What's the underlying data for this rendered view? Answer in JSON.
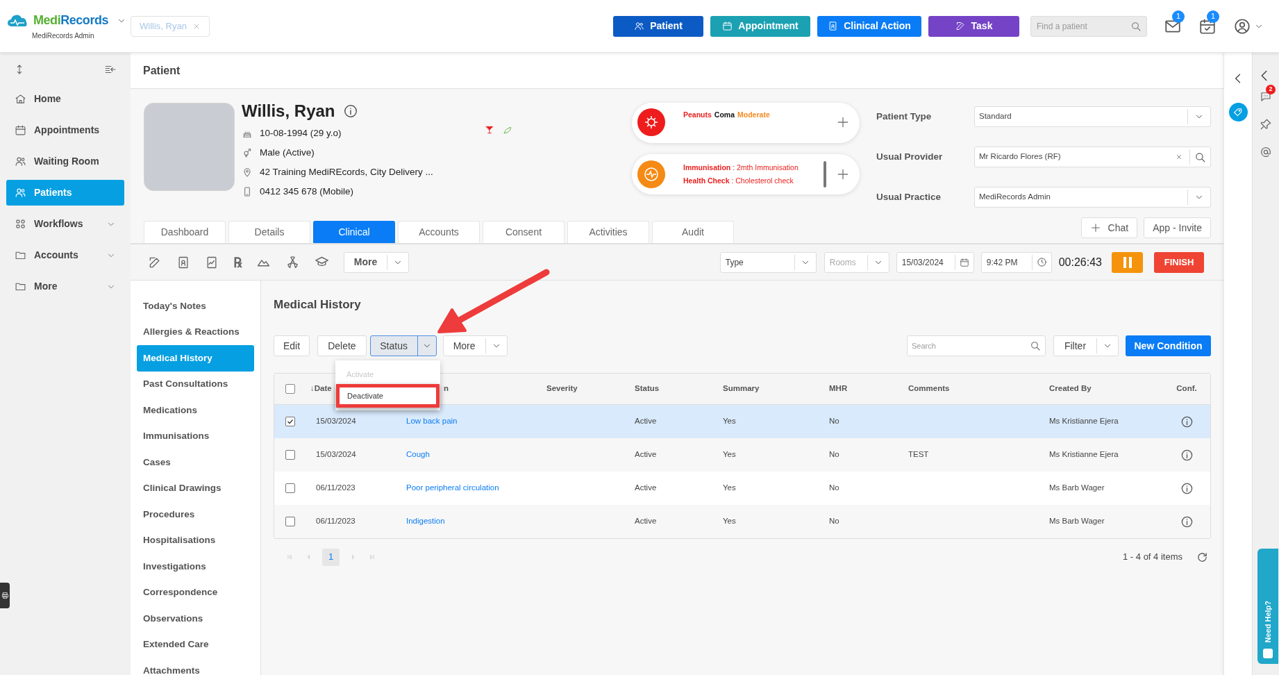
{
  "topbar": {
    "logo": {
      "brand_a": "Medi",
      "brand_b": "Records",
      "subtitle": "MediRecords Admin"
    },
    "open_tab": {
      "label": "Willis, Ryan"
    },
    "actions": [
      {
        "label": "Patient",
        "kind": "patient"
      },
      {
        "label": "Appointment",
        "kind": "appointment"
      },
      {
        "label": "Clinical Action",
        "kind": "clinical"
      },
      {
        "label": "Task",
        "kind": "task"
      }
    ],
    "search": {
      "placeholder": "Find a patient"
    },
    "mail_badge": "1",
    "tasks_badge": "1"
  },
  "sidebar": {
    "items": [
      {
        "label": "Home",
        "selected": false,
        "expandable": false
      },
      {
        "label": "Appointments",
        "selected": false,
        "expandable": false
      },
      {
        "label": "Waiting Room",
        "selected": false,
        "expandable": false
      },
      {
        "label": "Patients",
        "selected": true,
        "expandable": false
      },
      {
        "label": "Workflows",
        "selected": false,
        "expandable": true
      },
      {
        "label": "Accounts",
        "selected": false,
        "expandable": true
      },
      {
        "label": "More",
        "selected": false,
        "expandable": true
      }
    ]
  },
  "page_title": "Patient",
  "patient": {
    "name": "Willis, Ryan",
    "dob": "10-08-1994 (29 y.o)",
    "sex": "Male (Active)",
    "address": "42 Training MediREcords, City Delivery ...",
    "phone": "0412 345 678 (Mobile)"
  },
  "allergy": {
    "parts": [
      {
        "text": "Peanuts",
        "color": "#e8211f"
      },
      {
        "text": "Coma",
        "color": "#111111"
      },
      {
        "text": "Moderate",
        "color": "#f5891f"
      }
    ]
  },
  "alerts": [
    "**Immunisation** : 2mth Immunisation",
    "**Health Check** : Cholesterol check"
  ],
  "fields": [
    {
      "label": "Patient Type",
      "value": "Standard",
      "kind": "select"
    },
    {
      "label": "Usual Provider",
      "value": "Mr Ricardo Flores (RF)",
      "kind": "search"
    },
    {
      "label": "Usual Practice",
      "value": "MediRecords Admin",
      "kind": "select"
    }
  ],
  "header_buttons": [
    "Chat",
    "App - Invite"
  ],
  "tabs": [
    {
      "label": "Dashboard",
      "selected": false
    },
    {
      "label": "Details",
      "selected": false
    },
    {
      "label": "Clinical",
      "selected": true
    },
    {
      "label": "Accounts",
      "selected": false
    },
    {
      "label": "Consent",
      "selected": false
    },
    {
      "label": "Activities",
      "selected": false
    },
    {
      "label": "Audit",
      "selected": false
    }
  ],
  "toolbar": {
    "rx_icon": "℞",
    "more": "More",
    "type_placeholder": "Type",
    "rooms_placeholder": "Rooms",
    "date": "15/03/2024",
    "time": "9:42 PM",
    "timer": "00:26:43",
    "finish": "FINISH"
  },
  "clinical_nav": [
    {
      "label": "Today's Notes",
      "selected": false
    },
    {
      "label": "Allergies & Reactions",
      "selected": false
    },
    {
      "label": "Medical History",
      "selected": true
    },
    {
      "label": "Past Consultations",
      "selected": false
    },
    {
      "label": "Medications",
      "selected": false
    },
    {
      "label": "Immunisations",
      "selected": false
    },
    {
      "label": "Cases",
      "selected": false
    },
    {
      "label": "Clinical Drawings",
      "selected": false
    },
    {
      "label": "Procedures",
      "selected": false
    },
    {
      "label": "Hospitalisations",
      "selected": false
    },
    {
      "label": "Investigations",
      "selected": false
    },
    {
      "label": "Correspondence",
      "selected": false
    },
    {
      "label": "Observations",
      "selected": false
    },
    {
      "label": "Extended Care",
      "selected": false
    },
    {
      "label": "Attachments",
      "selected": false
    }
  ],
  "medical_history": {
    "title": "Medical History",
    "edit": "Edit",
    "delete": "Delete",
    "status": "Status",
    "more": "More",
    "status_menu": [
      {
        "label": "Activate",
        "disabled": true,
        "annotated": false
      },
      {
        "label": "Deactivate",
        "disabled": false,
        "annotated": true
      }
    ],
    "search_placeholder": "Search",
    "filter": "Filter",
    "new_button": "New Condition",
    "table": {
      "all_checked": false,
      "columns": [
        "↓Date",
        "n",
        "Severity",
        "Status",
        "Summary",
        "MHR",
        "Comments",
        "Created By",
        "Conf."
      ],
      "rows": [
        {
          "checked": true,
          "date": "15/03/2024",
          "condition": "Low back pain",
          "status": "Active",
          "summary": "Yes",
          "mhr": "No",
          "created_by": "Ms Kristianne Ejera"
        },
        {
          "checked": false,
          "date": "15/03/2024",
          "condition": "Cough",
          "status": "Active",
          "summary": "Yes",
          "mhr": "No",
          "comments": "TEST",
          "created_by": "Ms Kristianne Ejera"
        },
        {
          "checked": false,
          "date": "06/11/2023",
          "condition": "Poor peripheral circulation",
          "status": "Active",
          "summary": "Yes",
          "mhr": "No",
          "created_by": "Ms Barb Wager"
        },
        {
          "checked": false,
          "date": "06/11/2023",
          "condition": "Indigestion",
          "status": "Active",
          "summary": "Yes",
          "mhr": "No",
          "created_by": "Ms Barb Wager"
        }
      ]
    },
    "pagination": {
      "page": "1",
      "summary": "1 - 4 of 4 items"
    }
  },
  "right_rail": {
    "chat_badge": "2"
  },
  "help_tab": "Need Help?"
}
